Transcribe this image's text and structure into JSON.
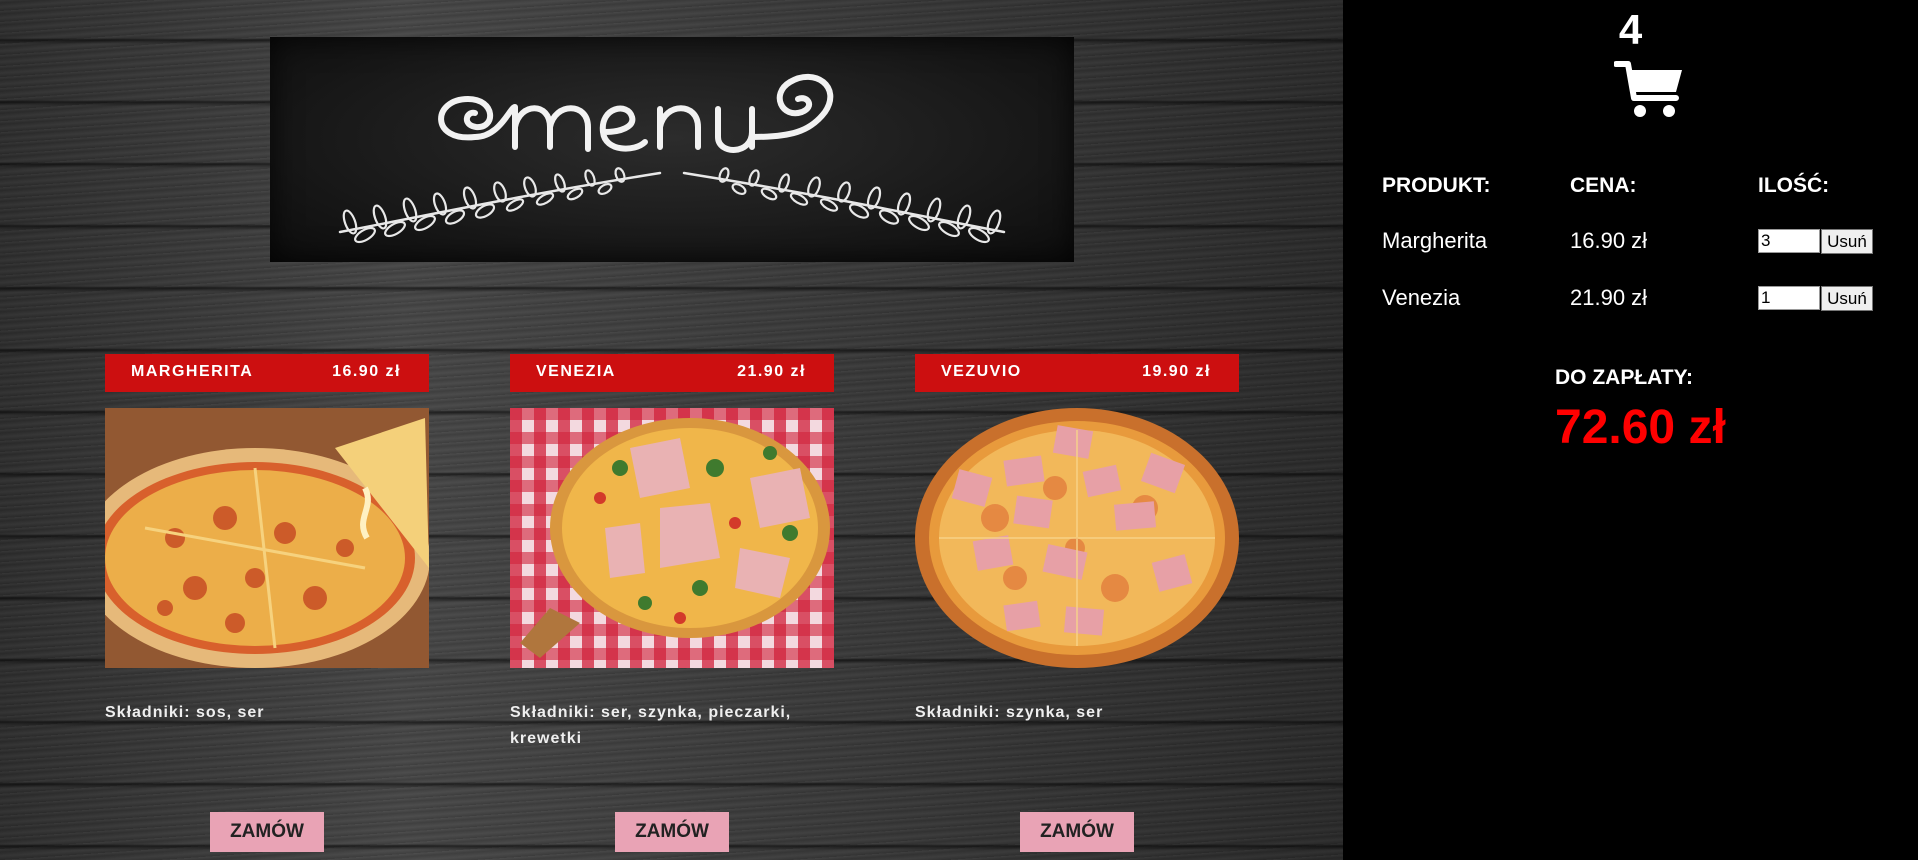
{
  "banner": {
    "title": "Menu"
  },
  "products": [
    {
      "name": "MARGHERITA",
      "price": "16.90 zł",
      "ingredients": "Składniki: sos, ser",
      "order_label": "ZAMÓW",
      "image": "margherita-pizza"
    },
    {
      "name": "VENEZIA",
      "price": "21.90 zł",
      "ingredients": "Składniki: ser, szynka, pieczarki, krewetki",
      "order_label": "ZAMÓW",
      "image": "venezia-pizza"
    },
    {
      "name": "VEZUVIO",
      "price": "19.90 zł",
      "ingredients": "Składniki: szynka, ser",
      "order_label": "ZAMÓW",
      "image": "vezuvio-pizza"
    }
  ],
  "cart": {
    "count": "4",
    "icon": "cart-icon",
    "headers": {
      "product": "PRODUKT:",
      "price": "CENA:",
      "quantity": "ILOŚĆ:"
    },
    "items": [
      {
        "name": "Margherita",
        "price": "16.90 zł",
        "quantity": "3",
        "remove_label": "Usuń"
      },
      {
        "name": "Venezia",
        "price": "21.90 zł",
        "quantity": "1",
        "remove_label": "Usuń"
      }
    ],
    "total_label": "DO ZAPŁATY:",
    "total_value": "72.60 zł"
  },
  "colors": {
    "accent_red": "#cc0f10",
    "total_red": "#ff0000",
    "order_button": "#e9a3b5",
    "cart_bg": "#000000"
  }
}
